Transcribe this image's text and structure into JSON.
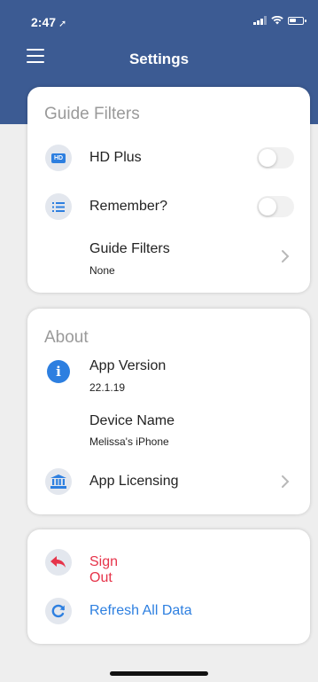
{
  "status_bar": {
    "time": "2:47"
  },
  "nav": {
    "title": "Settings"
  },
  "guide_filters": {
    "section_title": "Guide Filters",
    "hd_plus": {
      "label": "HD Plus",
      "icon_text": "HD",
      "enabled": false
    },
    "remember": {
      "label": "Remember?",
      "enabled": false
    },
    "filters": {
      "label": "Guide Filters",
      "value": "None"
    }
  },
  "about": {
    "section_title": "About",
    "app_version": {
      "label": "App Version",
      "value": "22.1.19"
    },
    "device_name": {
      "label": "Device Name",
      "value": "Melissa's iPhone"
    },
    "licensing": {
      "label": "App Licensing"
    }
  },
  "actions": {
    "sign_out": {
      "label": "Sign Out"
    },
    "refresh": {
      "label": "Refresh All Data"
    }
  },
  "colors": {
    "header": "#3c5b93",
    "accent_blue": "#2d7fe0",
    "destructive_red": "#e6344a",
    "background": "#eeeeee"
  }
}
